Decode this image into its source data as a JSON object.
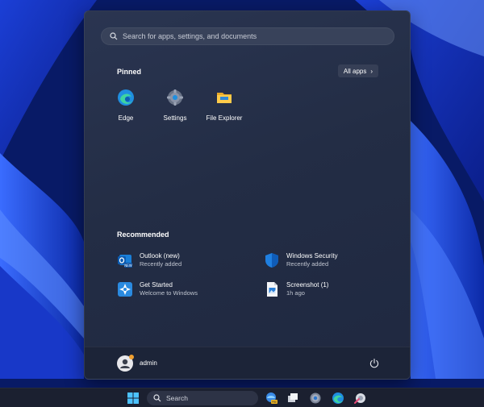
{
  "search": {
    "placeholder": "Search for apps, settings, and documents",
    "icon": "search-icon"
  },
  "pinned": {
    "title": "Pinned",
    "all_apps_label": "All apps",
    "apps": [
      {
        "label": "Edge",
        "icon": "edge-icon"
      },
      {
        "label": "Settings",
        "icon": "gear-icon"
      },
      {
        "label": "File Explorer",
        "icon": "folder-icon"
      }
    ]
  },
  "recommended": {
    "title": "Recommended",
    "items": [
      {
        "title": "Outlook (new)",
        "subtitle": "Recently added",
        "icon": "outlook-icon"
      },
      {
        "title": "Windows Security",
        "subtitle": "Recently added",
        "icon": "shield-icon"
      },
      {
        "title": "Get Started",
        "subtitle": "Welcome to Windows",
        "icon": "get-started-icon"
      },
      {
        "title": "Screenshot (1)",
        "subtitle": "1h ago",
        "icon": "image-file-icon"
      }
    ]
  },
  "user": {
    "name": "admin"
  },
  "taskbar": {
    "search_label": "Search",
    "icons": [
      "windows-start-icon",
      "copilot-icon",
      "task-view-icon",
      "gear-icon",
      "edge-icon",
      "snipping-tool-icon"
    ]
  },
  "colors": {
    "accent": "#0078d4",
    "menu_bg": "#252e46",
    "wallpaper": "#0a1c6e"
  }
}
